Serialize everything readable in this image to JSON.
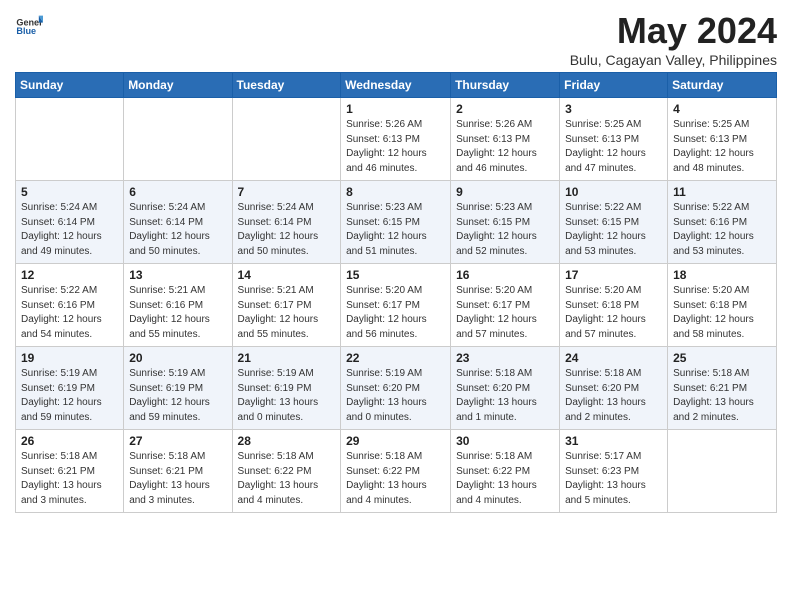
{
  "header": {
    "logo_general": "General",
    "logo_blue": "Blue",
    "month_title": "May 2024",
    "location": "Bulu, Cagayan Valley, Philippines"
  },
  "weekdays": [
    "Sunday",
    "Monday",
    "Tuesday",
    "Wednesday",
    "Thursday",
    "Friday",
    "Saturday"
  ],
  "weeks": [
    [
      {
        "day": "",
        "info": ""
      },
      {
        "day": "",
        "info": ""
      },
      {
        "day": "",
        "info": ""
      },
      {
        "day": "1",
        "info": "Sunrise: 5:26 AM\nSunset: 6:13 PM\nDaylight: 12 hours\nand 46 minutes."
      },
      {
        "day": "2",
        "info": "Sunrise: 5:26 AM\nSunset: 6:13 PM\nDaylight: 12 hours\nand 46 minutes."
      },
      {
        "day": "3",
        "info": "Sunrise: 5:25 AM\nSunset: 6:13 PM\nDaylight: 12 hours\nand 47 minutes."
      },
      {
        "day": "4",
        "info": "Sunrise: 5:25 AM\nSunset: 6:13 PM\nDaylight: 12 hours\nand 48 minutes."
      }
    ],
    [
      {
        "day": "5",
        "info": "Sunrise: 5:24 AM\nSunset: 6:14 PM\nDaylight: 12 hours\nand 49 minutes."
      },
      {
        "day": "6",
        "info": "Sunrise: 5:24 AM\nSunset: 6:14 PM\nDaylight: 12 hours\nand 50 minutes."
      },
      {
        "day": "7",
        "info": "Sunrise: 5:24 AM\nSunset: 6:14 PM\nDaylight: 12 hours\nand 50 minutes."
      },
      {
        "day": "8",
        "info": "Sunrise: 5:23 AM\nSunset: 6:15 PM\nDaylight: 12 hours\nand 51 minutes."
      },
      {
        "day": "9",
        "info": "Sunrise: 5:23 AM\nSunset: 6:15 PM\nDaylight: 12 hours\nand 52 minutes."
      },
      {
        "day": "10",
        "info": "Sunrise: 5:22 AM\nSunset: 6:15 PM\nDaylight: 12 hours\nand 53 minutes."
      },
      {
        "day": "11",
        "info": "Sunrise: 5:22 AM\nSunset: 6:16 PM\nDaylight: 12 hours\nand 53 minutes."
      }
    ],
    [
      {
        "day": "12",
        "info": "Sunrise: 5:22 AM\nSunset: 6:16 PM\nDaylight: 12 hours\nand 54 minutes."
      },
      {
        "day": "13",
        "info": "Sunrise: 5:21 AM\nSunset: 6:16 PM\nDaylight: 12 hours\nand 55 minutes."
      },
      {
        "day": "14",
        "info": "Sunrise: 5:21 AM\nSunset: 6:17 PM\nDaylight: 12 hours\nand 55 minutes."
      },
      {
        "day": "15",
        "info": "Sunrise: 5:20 AM\nSunset: 6:17 PM\nDaylight: 12 hours\nand 56 minutes."
      },
      {
        "day": "16",
        "info": "Sunrise: 5:20 AM\nSunset: 6:17 PM\nDaylight: 12 hours\nand 57 minutes."
      },
      {
        "day": "17",
        "info": "Sunrise: 5:20 AM\nSunset: 6:18 PM\nDaylight: 12 hours\nand 57 minutes."
      },
      {
        "day": "18",
        "info": "Sunrise: 5:20 AM\nSunset: 6:18 PM\nDaylight: 12 hours\nand 58 minutes."
      }
    ],
    [
      {
        "day": "19",
        "info": "Sunrise: 5:19 AM\nSunset: 6:19 PM\nDaylight: 12 hours\nand 59 minutes."
      },
      {
        "day": "20",
        "info": "Sunrise: 5:19 AM\nSunset: 6:19 PM\nDaylight: 12 hours\nand 59 minutes."
      },
      {
        "day": "21",
        "info": "Sunrise: 5:19 AM\nSunset: 6:19 PM\nDaylight: 13 hours\nand 0 minutes."
      },
      {
        "day": "22",
        "info": "Sunrise: 5:19 AM\nSunset: 6:20 PM\nDaylight: 13 hours\nand 0 minutes."
      },
      {
        "day": "23",
        "info": "Sunrise: 5:18 AM\nSunset: 6:20 PM\nDaylight: 13 hours\nand 1 minute."
      },
      {
        "day": "24",
        "info": "Sunrise: 5:18 AM\nSunset: 6:20 PM\nDaylight: 13 hours\nand 2 minutes."
      },
      {
        "day": "25",
        "info": "Sunrise: 5:18 AM\nSunset: 6:21 PM\nDaylight: 13 hours\nand 2 minutes."
      }
    ],
    [
      {
        "day": "26",
        "info": "Sunrise: 5:18 AM\nSunset: 6:21 PM\nDaylight: 13 hours\nand 3 minutes."
      },
      {
        "day": "27",
        "info": "Sunrise: 5:18 AM\nSunset: 6:21 PM\nDaylight: 13 hours\nand 3 minutes."
      },
      {
        "day": "28",
        "info": "Sunrise: 5:18 AM\nSunset: 6:22 PM\nDaylight: 13 hours\nand 4 minutes."
      },
      {
        "day": "29",
        "info": "Sunrise: 5:18 AM\nSunset: 6:22 PM\nDaylight: 13 hours\nand 4 minutes."
      },
      {
        "day": "30",
        "info": "Sunrise: 5:18 AM\nSunset: 6:22 PM\nDaylight: 13 hours\nand 4 minutes."
      },
      {
        "day": "31",
        "info": "Sunrise: 5:17 AM\nSunset: 6:23 PM\nDaylight: 13 hours\nand 5 minutes."
      },
      {
        "day": "",
        "info": ""
      }
    ]
  ]
}
